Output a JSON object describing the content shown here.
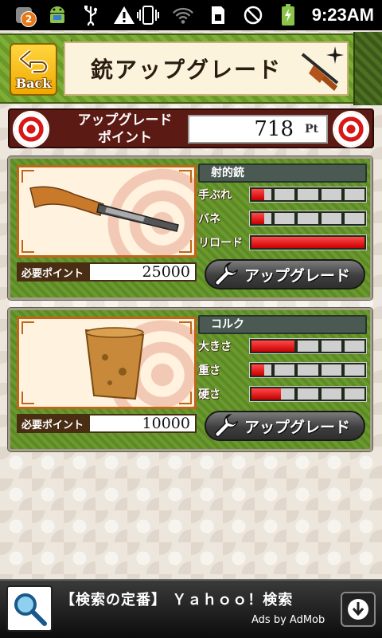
{
  "status_bar": {
    "notification_count": "2",
    "time": "9:23AM",
    "icons": [
      "android-icon",
      "usb-icon",
      "warning-icon",
      "vibrate-icon",
      "wifi-icon",
      "sim-icon",
      "no-signal-icon",
      "battery-charging-icon"
    ]
  },
  "header": {
    "back_label": "Back",
    "title": "銃アップグレード"
  },
  "points": {
    "label_line1": "アップグレード",
    "label_line2": "ポイント",
    "value": "718",
    "unit": "Pt"
  },
  "upgrades": [
    {
      "name": "射的銃",
      "image": "rifle-image",
      "stats": [
        {
          "label": "手ぶれ",
          "level": 0.14
        },
        {
          "label": "バネ",
          "level": 0.14
        },
        {
          "label": "リロード",
          "level": 1.0
        }
      ],
      "required_label": "必要ポイント",
      "required_value": "25000",
      "button_label": "アップグレード"
    },
    {
      "name": "コルク",
      "image": "cork-image",
      "stats": [
        {
          "label": "大きさ",
          "level": 0.4
        },
        {
          "label": "重さ",
          "level": 0.14
        },
        {
          "label": "硬さ",
          "level": 0.28
        }
      ],
      "required_label": "必要ポイント",
      "required_value": "10000",
      "button_label": "アップグレード"
    }
  ],
  "ad": {
    "title": "【検索の定番】 Ｙａｈｏｏ！検索",
    "source": "Ads by AdMob"
  },
  "colors": {
    "accent_red": "#d81818",
    "banner_green": "#6c9a2a",
    "stat_fill": "#e01010"
  }
}
